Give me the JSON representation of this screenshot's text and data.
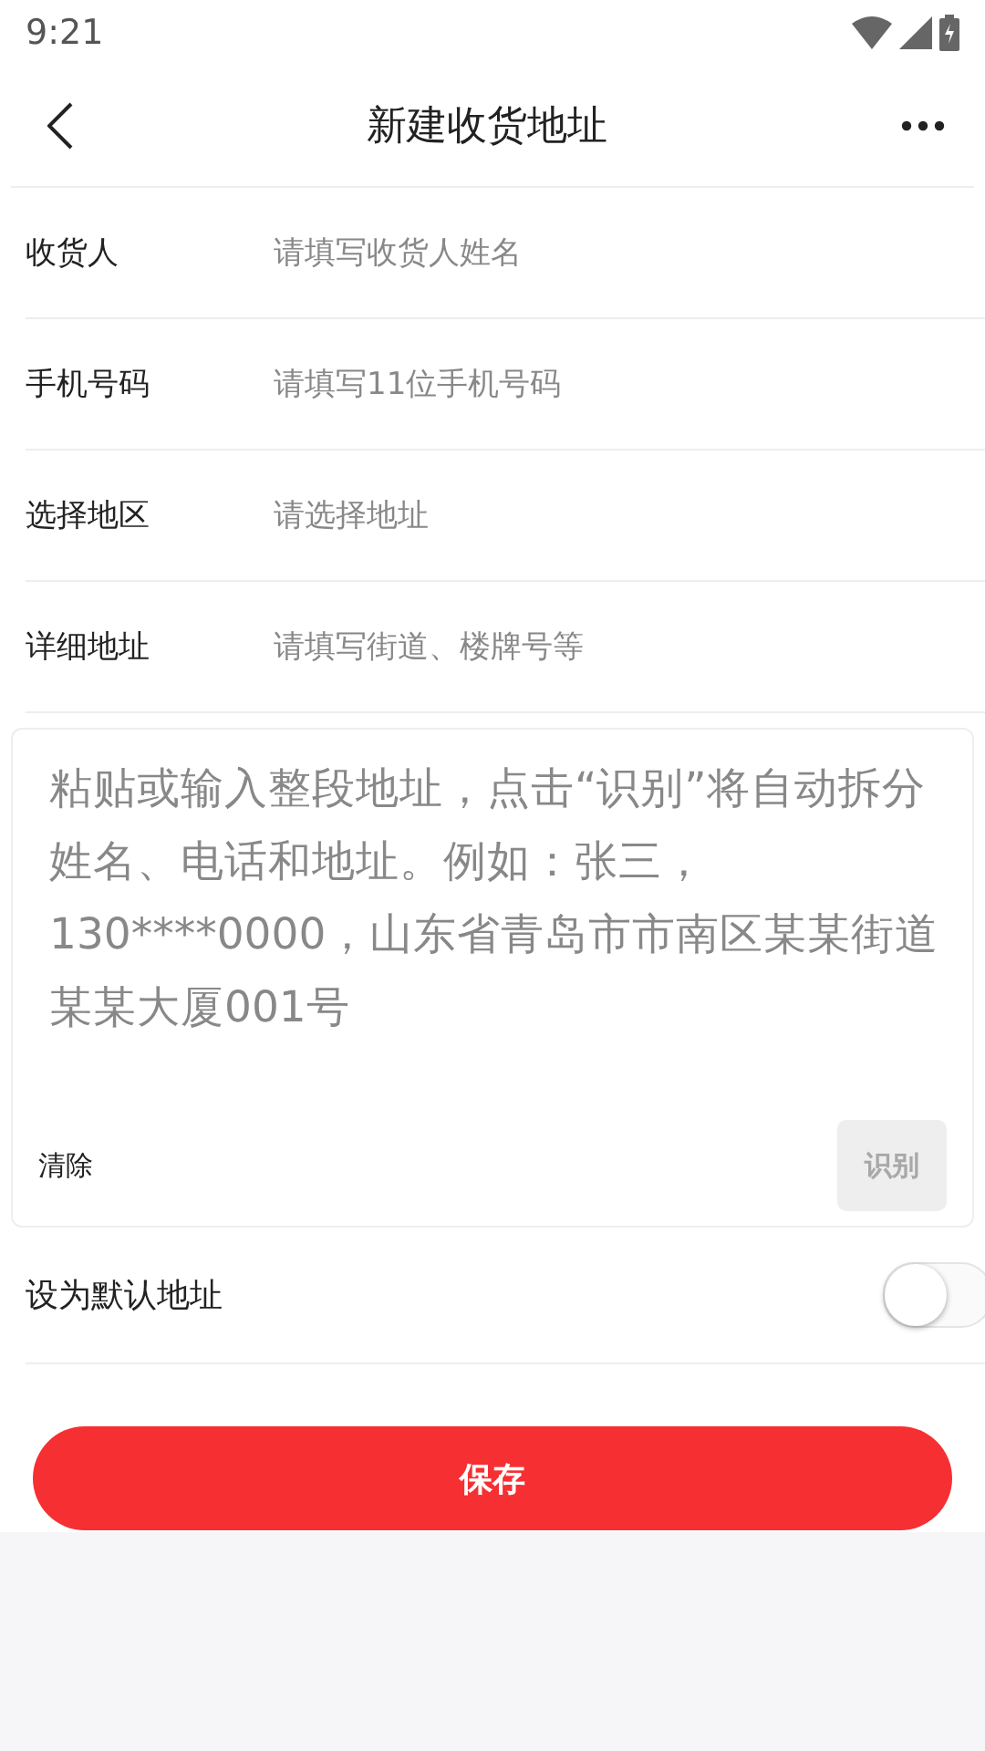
{
  "status_bar": {
    "time": "9:21"
  },
  "header": {
    "title": "新建收货地址"
  },
  "fields": [
    {
      "label": "收货人",
      "placeholder": "请填写收货人姓名"
    },
    {
      "label": "手机号码",
      "placeholder": "请填写11位手机号码"
    },
    {
      "label": "选择地区",
      "placeholder": "请选择地址"
    },
    {
      "label": "详细地址",
      "placeholder": "请填写街道、楼牌号等"
    }
  ],
  "paste_box": {
    "placeholder": "粘贴或输入整段地址，点击“识别”将自动拆分姓名、电话和地址。例如：张三，130****0000，山东省青岛市市南区某某街道某某大厦001号",
    "clear_label": "清除",
    "recognize": {
      "label": "识别",
      "disabled": true
    }
  },
  "default_address": {
    "label": "设为默认地址",
    "on": false
  },
  "save_button": "保存"
}
